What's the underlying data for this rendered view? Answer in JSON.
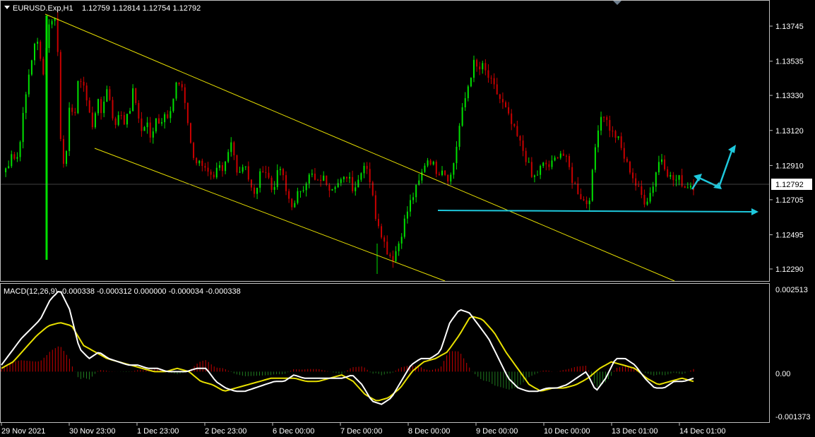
{
  "price_panel": {
    "symbol_header": "EURUSD.Exp,H1",
    "ohlc": "1.12759 1.12814 1.12754 1.12792",
    "current_price": "1.12792",
    "y_ticks": [
      "1.13745",
      "1.13535",
      "1.13330",
      "1.13120",
      "1.12910",
      "1.12705",
      "1.12495",
      "1.12290"
    ]
  },
  "macd_panel": {
    "header": "MACD(12,26,9) -0.000338 -0.000312 0.000000 -0.000034 -0.000338",
    "y_ticks": [
      "0.002513",
      "0.00",
      "-0.001373"
    ]
  },
  "time_axis": {
    "labels": [
      "29 Nov 2021",
      "30 Nov 23:00",
      "1 Dec 23:00",
      "2 Dec 23:00",
      "6 Dec 00:00",
      "7 Dec 00:00",
      "8 Dec 00:00",
      "9 Dec 00:00",
      "10 Dec 00:00",
      "13 Dec 01:00",
      "14 Dec 01:00"
    ]
  },
  "colors": {
    "background": "#000000",
    "bull_candle": "#00e000",
    "bear_candle": "#c80000",
    "channel_line": "#e8e000",
    "annotation": "#1ec8dc",
    "macd_main": "#ffffff",
    "macd_signal": "#e8e000",
    "grid_border": "#bfbfbf"
  },
  "chart_data": {
    "type": "candlestick",
    "price_path": [
      1.1287,
      1.129,
      1.13,
      1.1292,
      1.131,
      1.133,
      1.135,
      1.1362,
      1.1365,
      1.1345,
      1.1372,
      1.138,
      1.1378,
      1.13,
      1.129,
      1.133,
      1.132,
      1.1345,
      1.134,
      1.1325,
      1.1315,
      1.133,
      1.1322,
      1.1338,
      1.133,
      1.1312,
      1.1325,
      1.1318,
      1.132,
      1.1335,
      1.1325,
      1.131,
      1.1318,
      1.1305,
      1.1322,
      1.1315,
      1.1325,
      1.1318,
      1.133,
      1.1342,
      1.1338,
      1.1322,
      1.13,
      1.1292,
      1.1296,
      1.1288,
      1.129,
      1.1282,
      1.129,
      1.1285,
      1.1295,
      1.1305,
      1.129,
      1.1288,
      1.1294,
      1.128,
      1.1272,
      1.1282,
      1.129,
      1.1286,
      1.1276,
      1.1284,
      1.129,
      1.1276,
      1.127,
      1.1266,
      1.1276,
      1.1279,
      1.1284,
      1.1285,
      1.1279,
      1.1284,
      1.1282,
      1.1278,
      1.1281,
      1.128,
      1.1282,
      1.1287,
      1.1278,
      1.128,
      1.129,
      1.1293,
      1.128,
      1.1262,
      1.1255,
      1.1245,
      1.1238,
      1.1236,
      1.1242,
      1.1252,
      1.1262,
      1.127,
      1.1276,
      1.1282,
      1.1292,
      1.1296,
      1.1291,
      1.1287,
      1.129,
      1.1284,
      1.1285,
      1.13,
      1.1318,
      1.133,
      1.1342,
      1.1352,
      1.1348,
      1.135,
      1.1345,
      1.134,
      1.1335,
      1.133,
      1.1325,
      1.1318,
      1.1312,
      1.1306,
      1.13,
      1.1293,
      1.1283,
      1.1285,
      1.129,
      1.1292,
      1.129,
      1.1294,
      1.13,
      1.1297,
      1.1292,
      1.1282,
      1.1277,
      1.1272,
      1.1268,
      1.1274,
      1.13,
      1.132,
      1.1322,
      1.1315,
      1.131,
      1.1308,
      1.13,
      1.1292,
      1.1288,
      1.128,
      1.1275,
      1.127,
      1.1272,
      1.128,
      1.1292,
      1.1296,
      1.1288,
      1.1283,
      1.1282,
      1.1283,
      1.1278,
      1.128,
      1.1279
    ],
    "channel_upper": {
      "from": [
        "29 Nov",
        1.1379
      ],
      "to": [
        "14 Dec",
        1.122
      ]
    },
    "channel_lower": {
      "from": [
        "30 Nov",
        1.1301
      ],
      "to": [
        "8 Dec",
        1.122
      ]
    },
    "support_line": 1.1266,
    "macd_main_path": [
      0.0002,
      0.0006,
      0.001,
      0.0013,
      0.0016,
      0.0022,
      0.0025,
      0.0019,
      0.0007,
      0.0004,
      0.0006,
      0.0004,
      0.0003,
      0.0002,
      0.0002,
      0.0001,
      0.0001,
      0.0,
      0.0,
      0.0,
      0.0001,
      0.0001,
      -0.0003,
      -0.0005,
      -0.0006,
      -0.0006,
      -0.0005,
      -0.0004,
      -0.0003,
      -0.0003,
      -0.0001,
      -0.0002,
      -0.0002,
      -0.0002,
      -0.0002,
      -0.0002,
      -0.0001,
      -0.0004,
      -0.0009,
      -0.001,
      -0.0008,
      -0.0003,
      0.0002,
      0.0004,
      0.0004,
      0.0006,
      0.0015,
      0.0019,
      0.0018,
      0.0014,
      0.001,
      0.0004,
      -0.0002,
      -0.0005,
      -0.0006,
      -0.0006,
      -0.0005,
      -0.0005,
      -0.0004,
      -0.0002,
      0.0,
      -0.0006,
      -0.0002,
      0.0004,
      0.0004,
      0.0002,
      -0.0002,
      -0.0005,
      -0.0005,
      -0.0003,
      -0.0003,
      -0.0002
    ],
    "macd_signal_path": [
      0.0001,
      0.0003,
      0.0007,
      0.0011,
      0.0014,
      0.0015,
      0.0014,
      0.0008,
      0.0006,
      0.0004,
      0.0003,
      0.0002,
      0.0001,
      0.0,
      0.0,
      0.0001,
      0.0,
      -0.0003,
      -0.0004,
      -0.0006,
      -0.0005,
      -0.0004,
      -0.0003,
      -0.0002,
      -0.0002,
      -0.0002,
      -0.0003,
      -0.0003,
      -0.0002,
      -0.0001,
      -0.0003,
      -0.0007,
      -0.0009,
      -0.0008,
      -0.0005,
      0.0,
      0.0003,
      0.0004,
      0.0006,
      0.0011,
      0.0017,
      0.0016,
      0.0012,
      0.0006,
      0.0001,
      -0.0004,
      -0.0006,
      -0.0005,
      -0.0005,
      -0.0004,
      -0.0002,
      0.0001,
      0.0003,
      0.0002,
      0.0001,
      -0.0002,
      -0.0004,
      -0.0003,
      -0.0002,
      -0.0003
    ]
  }
}
